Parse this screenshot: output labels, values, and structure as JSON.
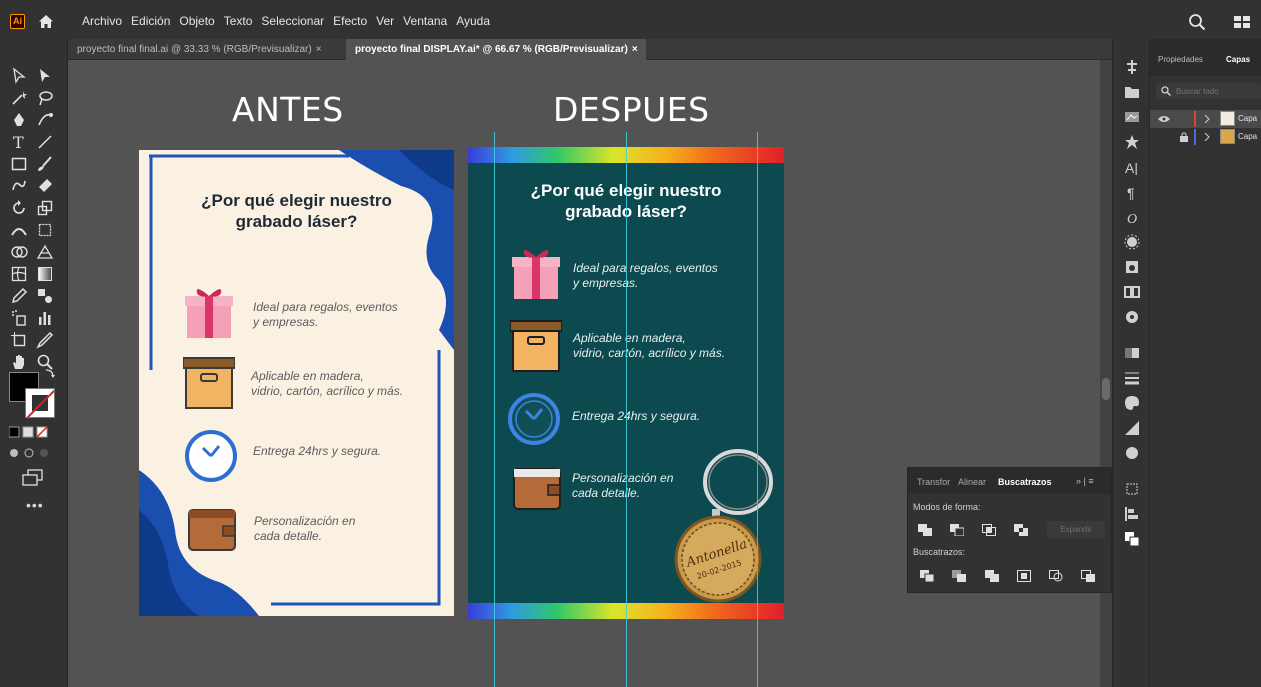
{
  "app": {
    "logo": "Ai",
    "menu": [
      "Archivo",
      "Edición",
      "Objeto",
      "Texto",
      "Seleccionar",
      "Efecto",
      "Ver",
      "Ventana",
      "Ayuda"
    ]
  },
  "tabs": [
    {
      "label": "proyecto final final.ai @ 33.33 % (RGB/Previsualizar)",
      "close": "×"
    },
    {
      "label": "proyecto final DISPLAY.ai* @ 66.67 % (RGB/Previsualizar)",
      "close": "×"
    }
  ],
  "canvas": {
    "before_heading": "ANTES",
    "after_heading": "DESPUES",
    "flyer_title": "¿Por qué elegir nuestro\ngrabado láser?",
    "features": [
      {
        "icon": "gift-icon",
        "text": "Ideal para regalos, eventos\ny empresas."
      },
      {
        "icon": "box-icon",
        "text": "Aplicable en madera,\nvidrio, cartón, acrílico y más."
      },
      {
        "icon": "clock-icon",
        "text": "Entrega 24hrs y segura."
      },
      {
        "icon": "wallet-icon",
        "text": "Personalización en\ncada detalle."
      }
    ],
    "keychain_line1": "Antonella",
    "keychain_line2": "20-02-2015",
    "colors": {
      "before_bg": "#fbf1e2",
      "before_accent": "#1e55b8",
      "after_bg": "#0d4a4f",
      "guide": "#3fd0e4"
    }
  },
  "pathfinder": {
    "tabs": [
      "Transfor",
      "Alinear",
      "Buscatrazos"
    ],
    "active_tab": "Buscatrazos",
    "menu": "»  |  ≡",
    "shape_modes_label": "Modos de forma:",
    "expand_label": "Expandir",
    "pathfinders_label": "Buscatrazos:"
  },
  "layers_panel": {
    "tabs": [
      "Propiedades",
      "Capas"
    ],
    "active_tab": "Capas",
    "search_placeholder": "Buscar todo",
    "layers": [
      {
        "name": "Capa",
        "color": "#e04040"
      },
      {
        "name": "Capa",
        "color": "#4a6ae0"
      }
    ]
  }
}
